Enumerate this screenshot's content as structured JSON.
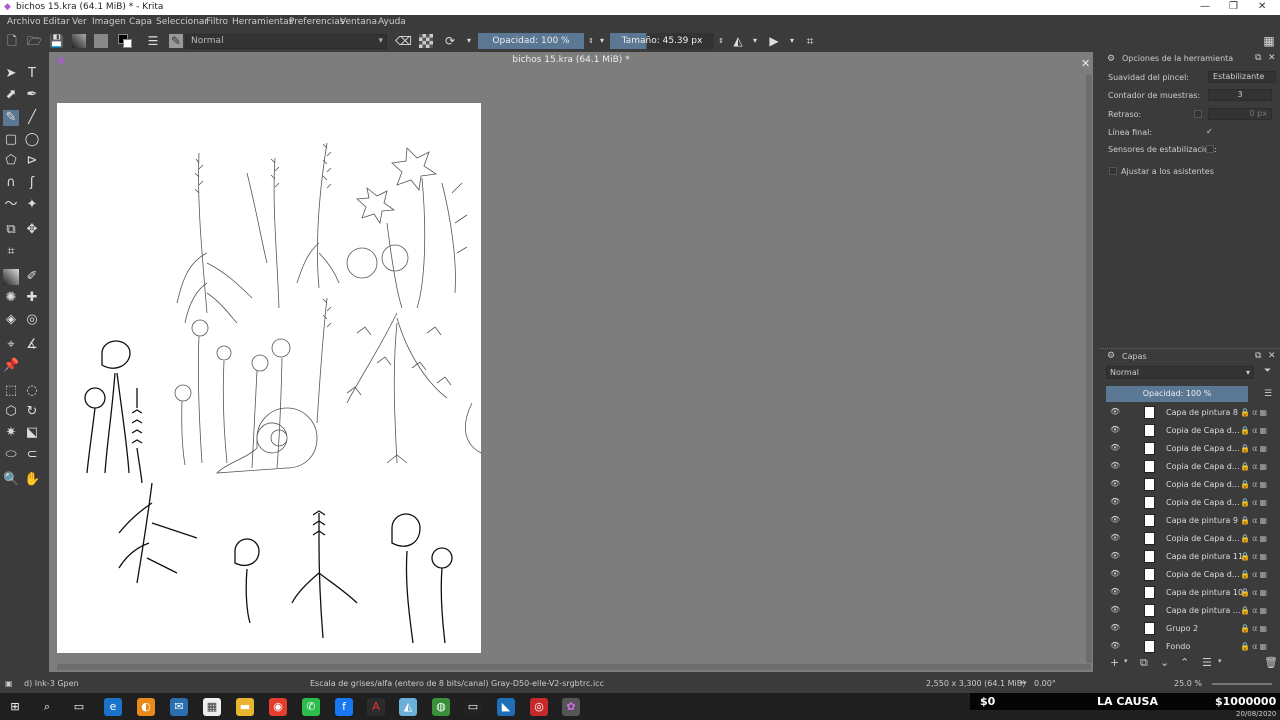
{
  "window": {
    "title": "bichos 15.kra (64.1 MiB) * - Krita"
  },
  "menu": [
    "Archivo",
    "Editar",
    "Ver",
    "Imagen",
    "Capa",
    "Seleccionar",
    "Filtro",
    "Herramientas",
    "Preferencias",
    "Ventana",
    "Ayuda"
  ],
  "toolbar": {
    "preset": "Normal",
    "opacity": "Opacidad: 100 %",
    "size": "Tamaño: 45.39 px"
  },
  "document": {
    "tab_title": "bichos 15.kra (64.1 MiB) *"
  },
  "tool_options": {
    "title": "Opciones de la herramienta",
    "smoothing_label": "Suavidad del pincel:",
    "smoothing_value": "Estabilizante",
    "sample_label": "Contador de muestras:",
    "sample_value": "3",
    "delay_label": "Retraso:",
    "delay_value": "0 px",
    "finish_label": "Línea final:",
    "finish_value": "✓",
    "sensors_label": "Sensores de estabilización:",
    "assistants_label": "Ajustar a los asistentes"
  },
  "layers_panel": {
    "title": "Capas",
    "blend": "Normal",
    "opacity": "Opacidad:  100 %",
    "layers": [
      {
        "name": "Capa de pintura 8"
      },
      {
        "name": "Copia de Capa d..."
      },
      {
        "name": "Copia de Capa d..."
      },
      {
        "name": "Copia de Capa d..."
      },
      {
        "name": "Copia de Capa d..."
      },
      {
        "name": "Copia de Capa d..."
      },
      {
        "name": "Capa de pintura 9"
      },
      {
        "name": "Copia de Capa d..."
      },
      {
        "name": "Capa de pintura 11"
      },
      {
        "name": "Copia de Capa d..."
      },
      {
        "name": "Capa de pintura 10"
      },
      {
        "name": "Capa de pintura ..."
      },
      {
        "name": "Grupo 2"
      },
      {
        "name": "Fondo"
      }
    ]
  },
  "status": {
    "brush": "d) Ink-3 Gpen",
    "color_space": "Escala de grises/alfa (entero de 8 bits/canal)  Gray-D50-elle-V2-srgbtrc.icc",
    "dimensions": "2,550 x 3,300 (64.1 MiB)",
    "rotation": "0.00°",
    "zoom": "25.0 %"
  },
  "overlay": {
    "left": "$0",
    "center": "LA CAUSA",
    "right": "$1000000"
  },
  "taskbar": {
    "date": "20/08/2020"
  }
}
